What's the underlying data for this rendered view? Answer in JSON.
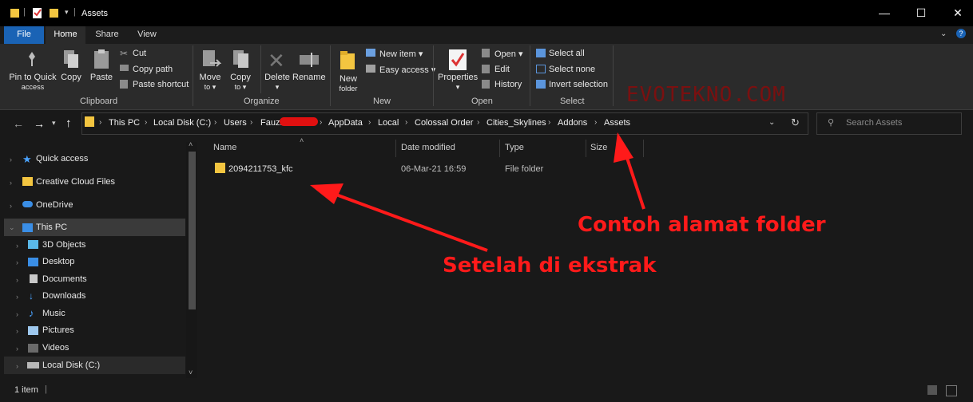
{
  "window": {
    "title": "Assets",
    "minimize": "—",
    "maximize": "☐",
    "close": "✕"
  },
  "tabs": {
    "file": "File",
    "home": "Home",
    "share": "Share",
    "view": "View"
  },
  "ribbon": {
    "clipboard": {
      "pin_line1": "Pin to Quick",
      "pin_line2": "access",
      "copy": "Copy",
      "paste": "Paste",
      "cut": "Cut",
      "copy_path": "Copy path",
      "paste_shortcut": "Paste shortcut",
      "group": "Clipboard"
    },
    "organize": {
      "move_to_1": "Move",
      "move_to_2": "to ▾",
      "copy_to_1": "Copy",
      "copy_to_2": "to ▾",
      "delete_1": "Delete",
      "delete_2": "▾",
      "rename": "Rename",
      "group": "Organize"
    },
    "new": {
      "new_folder_1": "New",
      "new_folder_2": "folder",
      "new_item": "New item ▾",
      "easy_access": "Easy access ▾",
      "group": "New"
    },
    "open": {
      "properties_1": "Properties",
      "properties_2": "▾",
      "open": "Open ▾",
      "edit": "Edit",
      "history": "History",
      "group": "Open"
    },
    "select": {
      "select_all": "Select all",
      "select_none": "Select none",
      "invert": "Invert selection",
      "group": "Select"
    }
  },
  "address": {
    "crumbs": [
      "This PC",
      "Local Disk (C:)",
      "Users",
      "Fauzi",
      "AppData",
      "Local",
      "Colossal Order",
      "Cities_Skylines",
      "Addons",
      "Assets"
    ],
    "search_placeholder": "Search Assets"
  },
  "nav": {
    "quick_access": "Quick access",
    "creative_cloud": "Creative Cloud Files",
    "onedrive": "OneDrive",
    "this_pc": "This PC",
    "objects3d": "3D Objects",
    "desktop": "Desktop",
    "documents": "Documents",
    "downloads": "Downloads",
    "music": "Music",
    "pictures": "Pictures",
    "videos": "Videos",
    "local_disk": "Local Disk (C:)"
  },
  "columns": {
    "name": "Name",
    "date": "Date modified",
    "type": "Type",
    "size": "Size"
  },
  "files": [
    {
      "name": "2094211753_kfc",
      "date": "06-Mar-21 16:59",
      "type": "File folder"
    }
  ],
  "status": {
    "count": "1 item"
  },
  "annotations": {
    "address_note": "Contoh alamat folder",
    "extract_note": "Setelah di ekstrak",
    "watermark": "EVOTEKNO.COM",
    "color": "#ff1a1a"
  }
}
